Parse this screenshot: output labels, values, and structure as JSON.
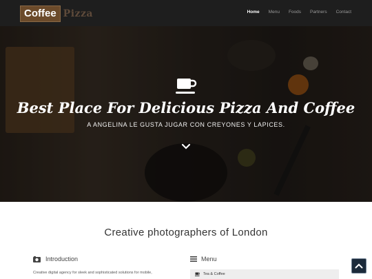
{
  "brand": {
    "name_part1": "Coffee",
    "name_part2": "Pizza"
  },
  "nav": {
    "items": [
      {
        "label": "Home",
        "active": true
      },
      {
        "label": "Menu",
        "active": false
      },
      {
        "label": "Foods",
        "active": false
      },
      {
        "label": "Partners",
        "active": false
      },
      {
        "label": "Contact",
        "active": false
      }
    ]
  },
  "hero": {
    "icon": "coffee-cup-icon",
    "title": "Best Place For Delicious Pizza And Coffee",
    "subtitle": "A ANGELINA LE GUSTA JUGAR CON CREYONES Y LAPICES.",
    "scroll_icon": "chevron-down-icon"
  },
  "section": {
    "title": "Creative photographers of London"
  },
  "intro": {
    "icon": "camera-icon",
    "heading": "Introduction",
    "text": "Creative digital agency for sleek and sophisticated solutions for mobile,"
  },
  "menu": {
    "icon": "hamburger-icon",
    "heading": "Menu",
    "items": [
      {
        "icon": "coffee-cup-icon",
        "label": "Tea & Coffee"
      }
    ]
  },
  "scroll_top": {
    "icon": "chevron-up-icon"
  },
  "colors": {
    "nav_bg": "#1e1e1e",
    "brand_bg": "#6b4a2a",
    "scroll_btn": "#1b2a3a"
  }
}
